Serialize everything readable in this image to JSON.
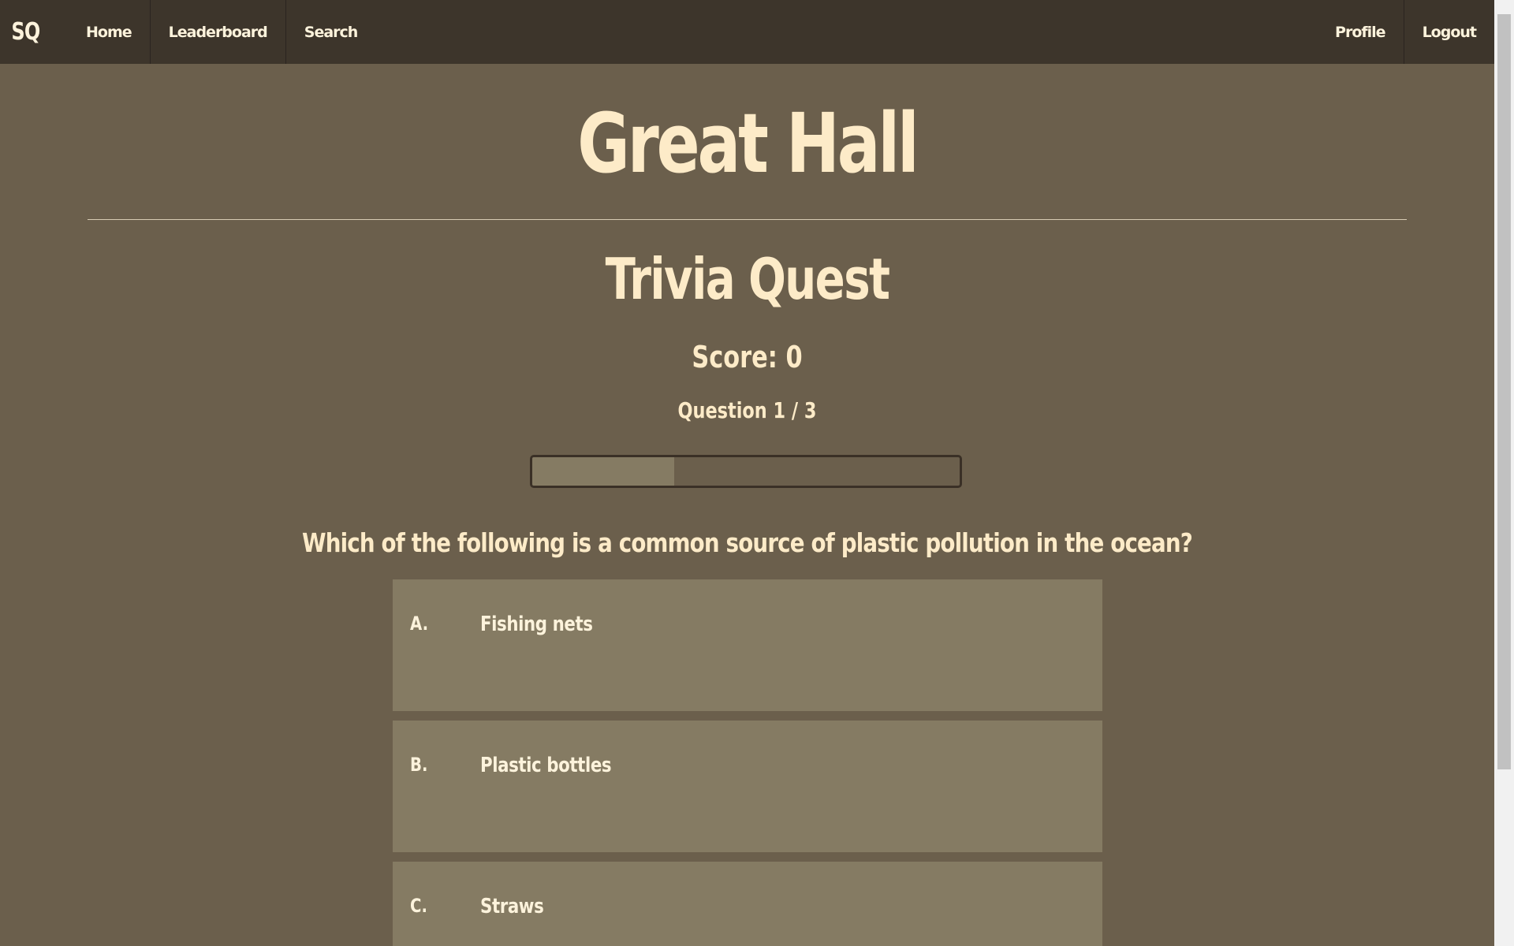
{
  "nav": {
    "brand": "SQ",
    "left_links": [
      "Home",
      "Leaderboard",
      "Search"
    ],
    "right_links": [
      "Profile",
      "Logout"
    ]
  },
  "page": {
    "title": "Great Hall",
    "quiz_title": "Trivia Quest",
    "score_text": "Score: 0",
    "question_count_text": "Question 1 / 3"
  },
  "progress": {
    "current": 1,
    "total": 3,
    "fraction": 0.333
  },
  "question": {
    "text": "Which of the following is a common source of plastic pollution in the ocean?",
    "answers": [
      {
        "letter": "A.",
        "text": "Fishing nets"
      },
      {
        "letter": "B.",
        "text": "Plastic bottles"
      },
      {
        "letter": "C.",
        "text": "Straws"
      }
    ]
  },
  "colors": {
    "background": "#6b5f4c",
    "navbar": "#3d352b",
    "answer_card": "#857b63",
    "heading_text": "#fdebc8"
  }
}
